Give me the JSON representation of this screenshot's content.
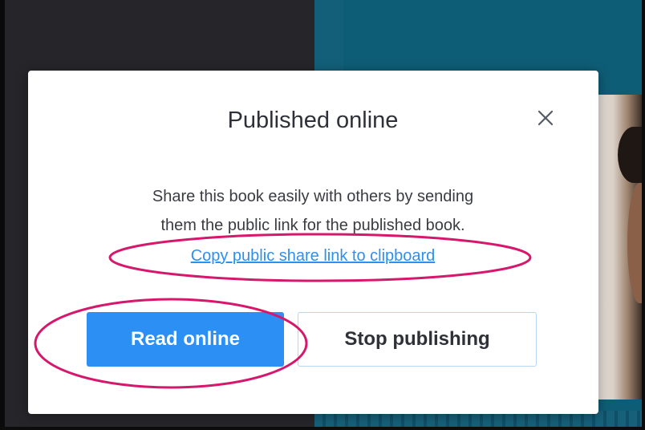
{
  "modal": {
    "title": "Published online",
    "close_icon": "close-icon",
    "description_line1": "Share this book easily with others by sending",
    "description_line2": "them the public link for the published book.",
    "copy_link_label": "Copy public share link to clipboard",
    "read_online_label": "Read online",
    "stop_publishing_label": "Stop publishing"
  },
  "colors": {
    "primary_button": "#2b8ff3",
    "link": "#2d8ff0",
    "annotation": "#d6186c",
    "secondary_border": "#b8d6f6"
  }
}
